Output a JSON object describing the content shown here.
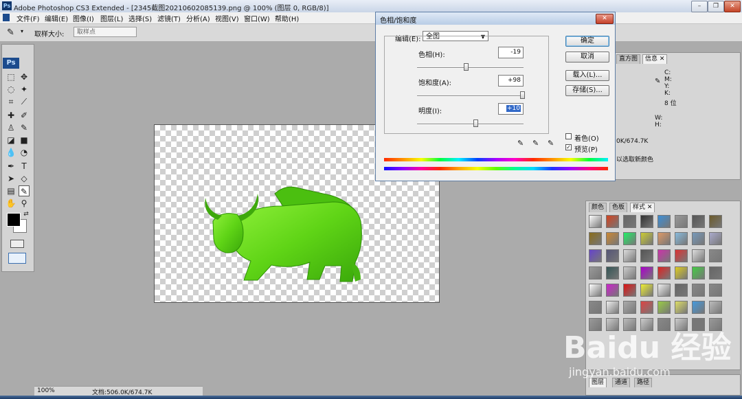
{
  "window": {
    "title": "Adobe Photoshop CS3 Extended - [2345截图20210602085139.png @ 100% (图层 0, RGB/8)]",
    "app_icon": "Ps"
  },
  "menu": [
    "文件(F)",
    "编辑(E)",
    "图像(I)",
    "图层(L)",
    "选择(S)",
    "滤镜(T)",
    "分析(A)",
    "视图(V)",
    "窗口(W)",
    "帮助(H)"
  ],
  "options_bar": {
    "label": "取样大小:",
    "select_value": "取样点"
  },
  "toolbox": {
    "logo": "Ps"
  },
  "status": {
    "zoom": "100%",
    "doc": "文档:506.0K/674.7K"
  },
  "dialog": {
    "title": "色相/饱和度",
    "edit_label": "编辑(E):",
    "edit_value": "全图",
    "hue": {
      "label": "色相(H):",
      "value": "-19",
      "fraction": 0.46
    },
    "saturation": {
      "label": "饱和度(A):",
      "value": "+98",
      "fraction": 0.99
    },
    "lightness": {
      "label": "明度(I):",
      "value": "+10",
      "fraction": 0.55
    },
    "buttons": {
      "ok": "确定",
      "cancel": "取消",
      "load": "载入(L)...",
      "save": "存储(S)..."
    },
    "colorize": {
      "label": "着色(O)",
      "checked": false
    },
    "preview": {
      "label": "预览(P)",
      "checked": true
    }
  },
  "info_panel": {
    "tabs": [
      "直方图",
      "信息"
    ],
    "cmyk_labels": [
      "C:",
      "M:",
      "Y:",
      "K:"
    ],
    "bits": "8 位",
    "wh_labels": [
      "W:",
      "H:"
    ],
    "doc": "0K/674.7K",
    "hint": "以选取新颜色"
  },
  "styles_panel": {
    "tabs": [
      "颜色",
      "色板",
      "样式"
    ]
  },
  "layers_panel": {
    "tabs": [
      "图层",
      "通道",
      "路径"
    ]
  },
  "watermark": {
    "brand": "Baidu 经验",
    "url": "jingyan.baidu.com"
  },
  "colors": {
    "green_image": "#6ee11f",
    "dialog_bg": "#f0f0f0"
  }
}
